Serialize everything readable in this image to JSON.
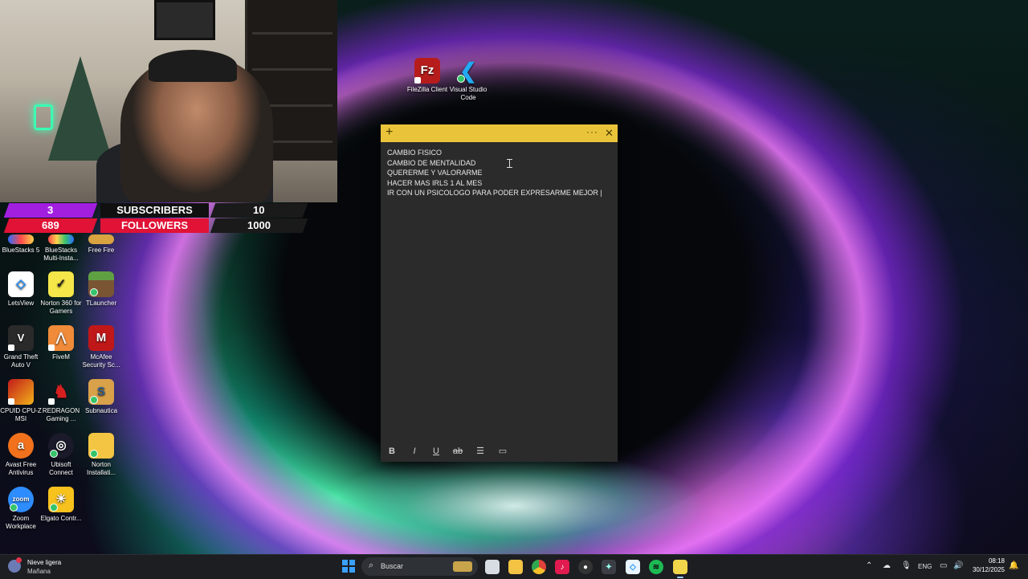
{
  "webcam_overlay": {
    "subscribers_current": "3",
    "subscribers_label": "SUBSCRIBERS",
    "subscribers_goal": "10",
    "followers_current": "689",
    "followers_label": "FOLLOWERS",
    "followers_goal": "1000"
  },
  "desktop_icons": {
    "filezilla": "FileZilla Client",
    "vscode": "Visual Studio Code",
    "bluestacks5": "BlueStacks 5",
    "bluestacks_multi": "BlueStacks Multi-Insta...",
    "freefire": "Free Fire",
    "letsview": "LetsView",
    "norton360": "Norton 360 for Gamers",
    "tlauncher": "TLauncher",
    "gta": "Grand Theft Auto V",
    "fivem": "FiveM",
    "mcafee": "McAfee Security Sc...",
    "cpuid": "CPUID CPU-Z MSI",
    "redragon": "REDRAGON Gaming ...",
    "subnautica": "Subnautica",
    "avast": "Avast Free Antivirus",
    "ubisoft": "Ubisoft Connect",
    "norton_install": "Norton Installati...",
    "zoom": "Zoom Workplace",
    "elgato": "Elgato Contr..."
  },
  "sticky_note": {
    "lines": [
      "CAMBIO FISICO",
      "CAMBIO DE MENTALIDAD",
      "QUERERME Y VALORARME",
      "HACER MAS IRLS 1 AL MES",
      "IR CON UN PSICOLOGO PARA PODER EXPRESARME MEJOR |"
    ],
    "color": "#e9c43b",
    "toolbar": {
      "bold": "B",
      "italic": "I",
      "underline": "U",
      "strike": "ab"
    }
  },
  "taskbar": {
    "weather_text": "Nieve ligera",
    "weather_sub": "Mañana",
    "search_placeholder": "Buscar",
    "language": "ENG",
    "time": "08:18",
    "date": "30/12/2025"
  }
}
